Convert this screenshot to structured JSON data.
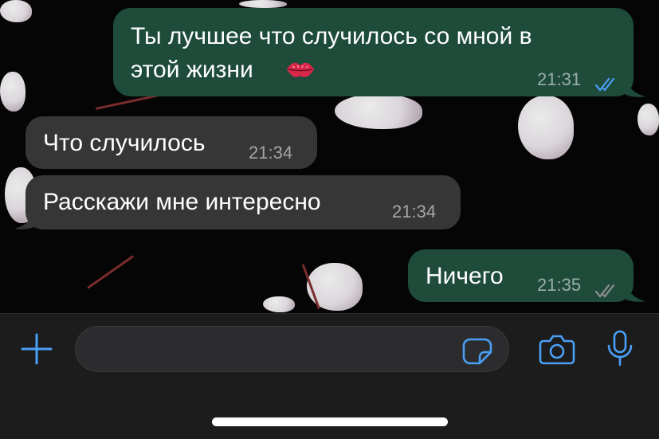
{
  "messages": [
    {
      "direction": "outgoing",
      "text_line1": "Ты лучшее что случилось со мной в",
      "text_line2": "этой жизни",
      "emoji": "kiss-mark",
      "time": "21:31",
      "status": "read"
    },
    {
      "direction": "incoming",
      "text": "Что случилось",
      "time": "21:34"
    },
    {
      "direction": "incoming",
      "text": "Расскажи мне интересно",
      "time": "21:34"
    },
    {
      "direction": "outgoing",
      "text": "Ничего",
      "time": "21:35",
      "status": "delivered"
    }
  ],
  "input": {
    "placeholder": "",
    "value": ""
  },
  "icons": {
    "attach": "plus-icon",
    "sticker": "sticker-icon",
    "camera": "camera-icon",
    "mic": "microphone-icon"
  },
  "colors": {
    "accent": "#4a9ff5",
    "outgoing_bubble": "#1e4b3a",
    "incoming_bubble": "#363636",
    "read_ticks": "#4a9ff5",
    "delivered_ticks": "#8e8e93"
  }
}
